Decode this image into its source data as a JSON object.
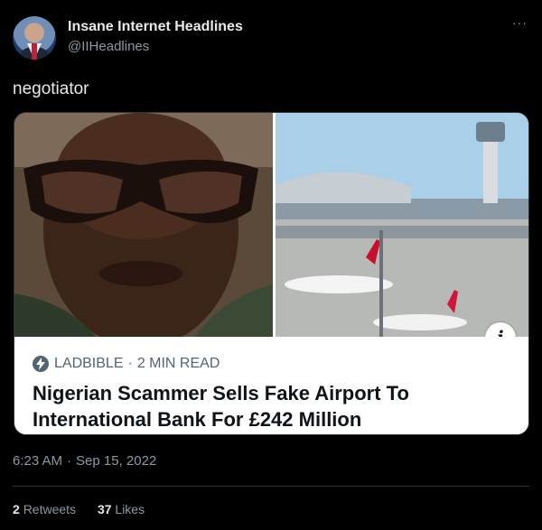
{
  "tweet": {
    "display_name": "Insane Internet Headlines",
    "handle": "@IIHeadlines",
    "more_glyph": "···",
    "text": "negotiator",
    "timestamp_time": "6:23 AM",
    "timestamp_dot": "·",
    "timestamp_date": "Sep 15, 2022"
  },
  "card": {
    "source": "LADBIBLE",
    "source_dot": "·",
    "read_time": "2 MIN READ",
    "headline": "Nigerian Scammer Sells Fake Airport To International Bank For £242 Million",
    "info_glyph": "i"
  },
  "stats": {
    "retweets_count": "2",
    "retweets_label": "Retweets",
    "likes_count": "37",
    "likes_label": "Likes"
  },
  "colors": {
    "background": "#000000",
    "text_primary": "#e7e9ea",
    "text_secondary": "#8b98a5",
    "card_background": "#ffffff",
    "headline": "#0f1419"
  }
}
